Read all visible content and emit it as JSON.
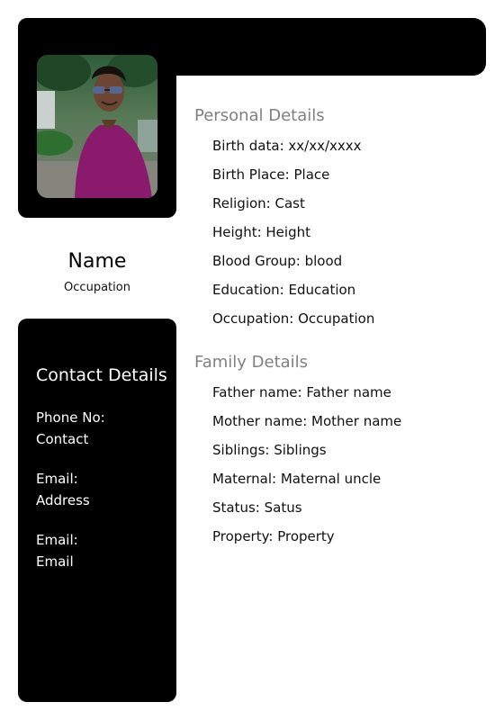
{
  "profile": {
    "name": "Name",
    "occupation": "Occupation",
    "photo_alt": "profile-photo"
  },
  "contact": {
    "title": "Contact Details",
    "items": [
      {
        "label": "Phone No:",
        "value": "Contact"
      },
      {
        "label": "Email:",
        "value": "Address"
      },
      {
        "label": "Email:",
        "value": "Email"
      }
    ]
  },
  "personal": {
    "title": "Personal Details",
    "items": [
      "Birth data: xx/xx/xxxx",
      "Birth Place: Place",
      "Religion: Cast",
      "Height: Height",
      "Blood Group: blood",
      "Education: Education",
      "Occupation: Occupation"
    ]
  },
  "family": {
    "title": "Family Details",
    "items": [
      "Father name: Father name",
      "Mother name: Mother name",
      "Siblings: Siblings",
      "Maternal: Maternal uncle",
      "Status: Satus",
      "Property: Property"
    ]
  },
  "colors": {
    "card": "#000000",
    "section_title": "#808080",
    "text": "#111111",
    "shirt": "#8a1a6b"
  }
}
